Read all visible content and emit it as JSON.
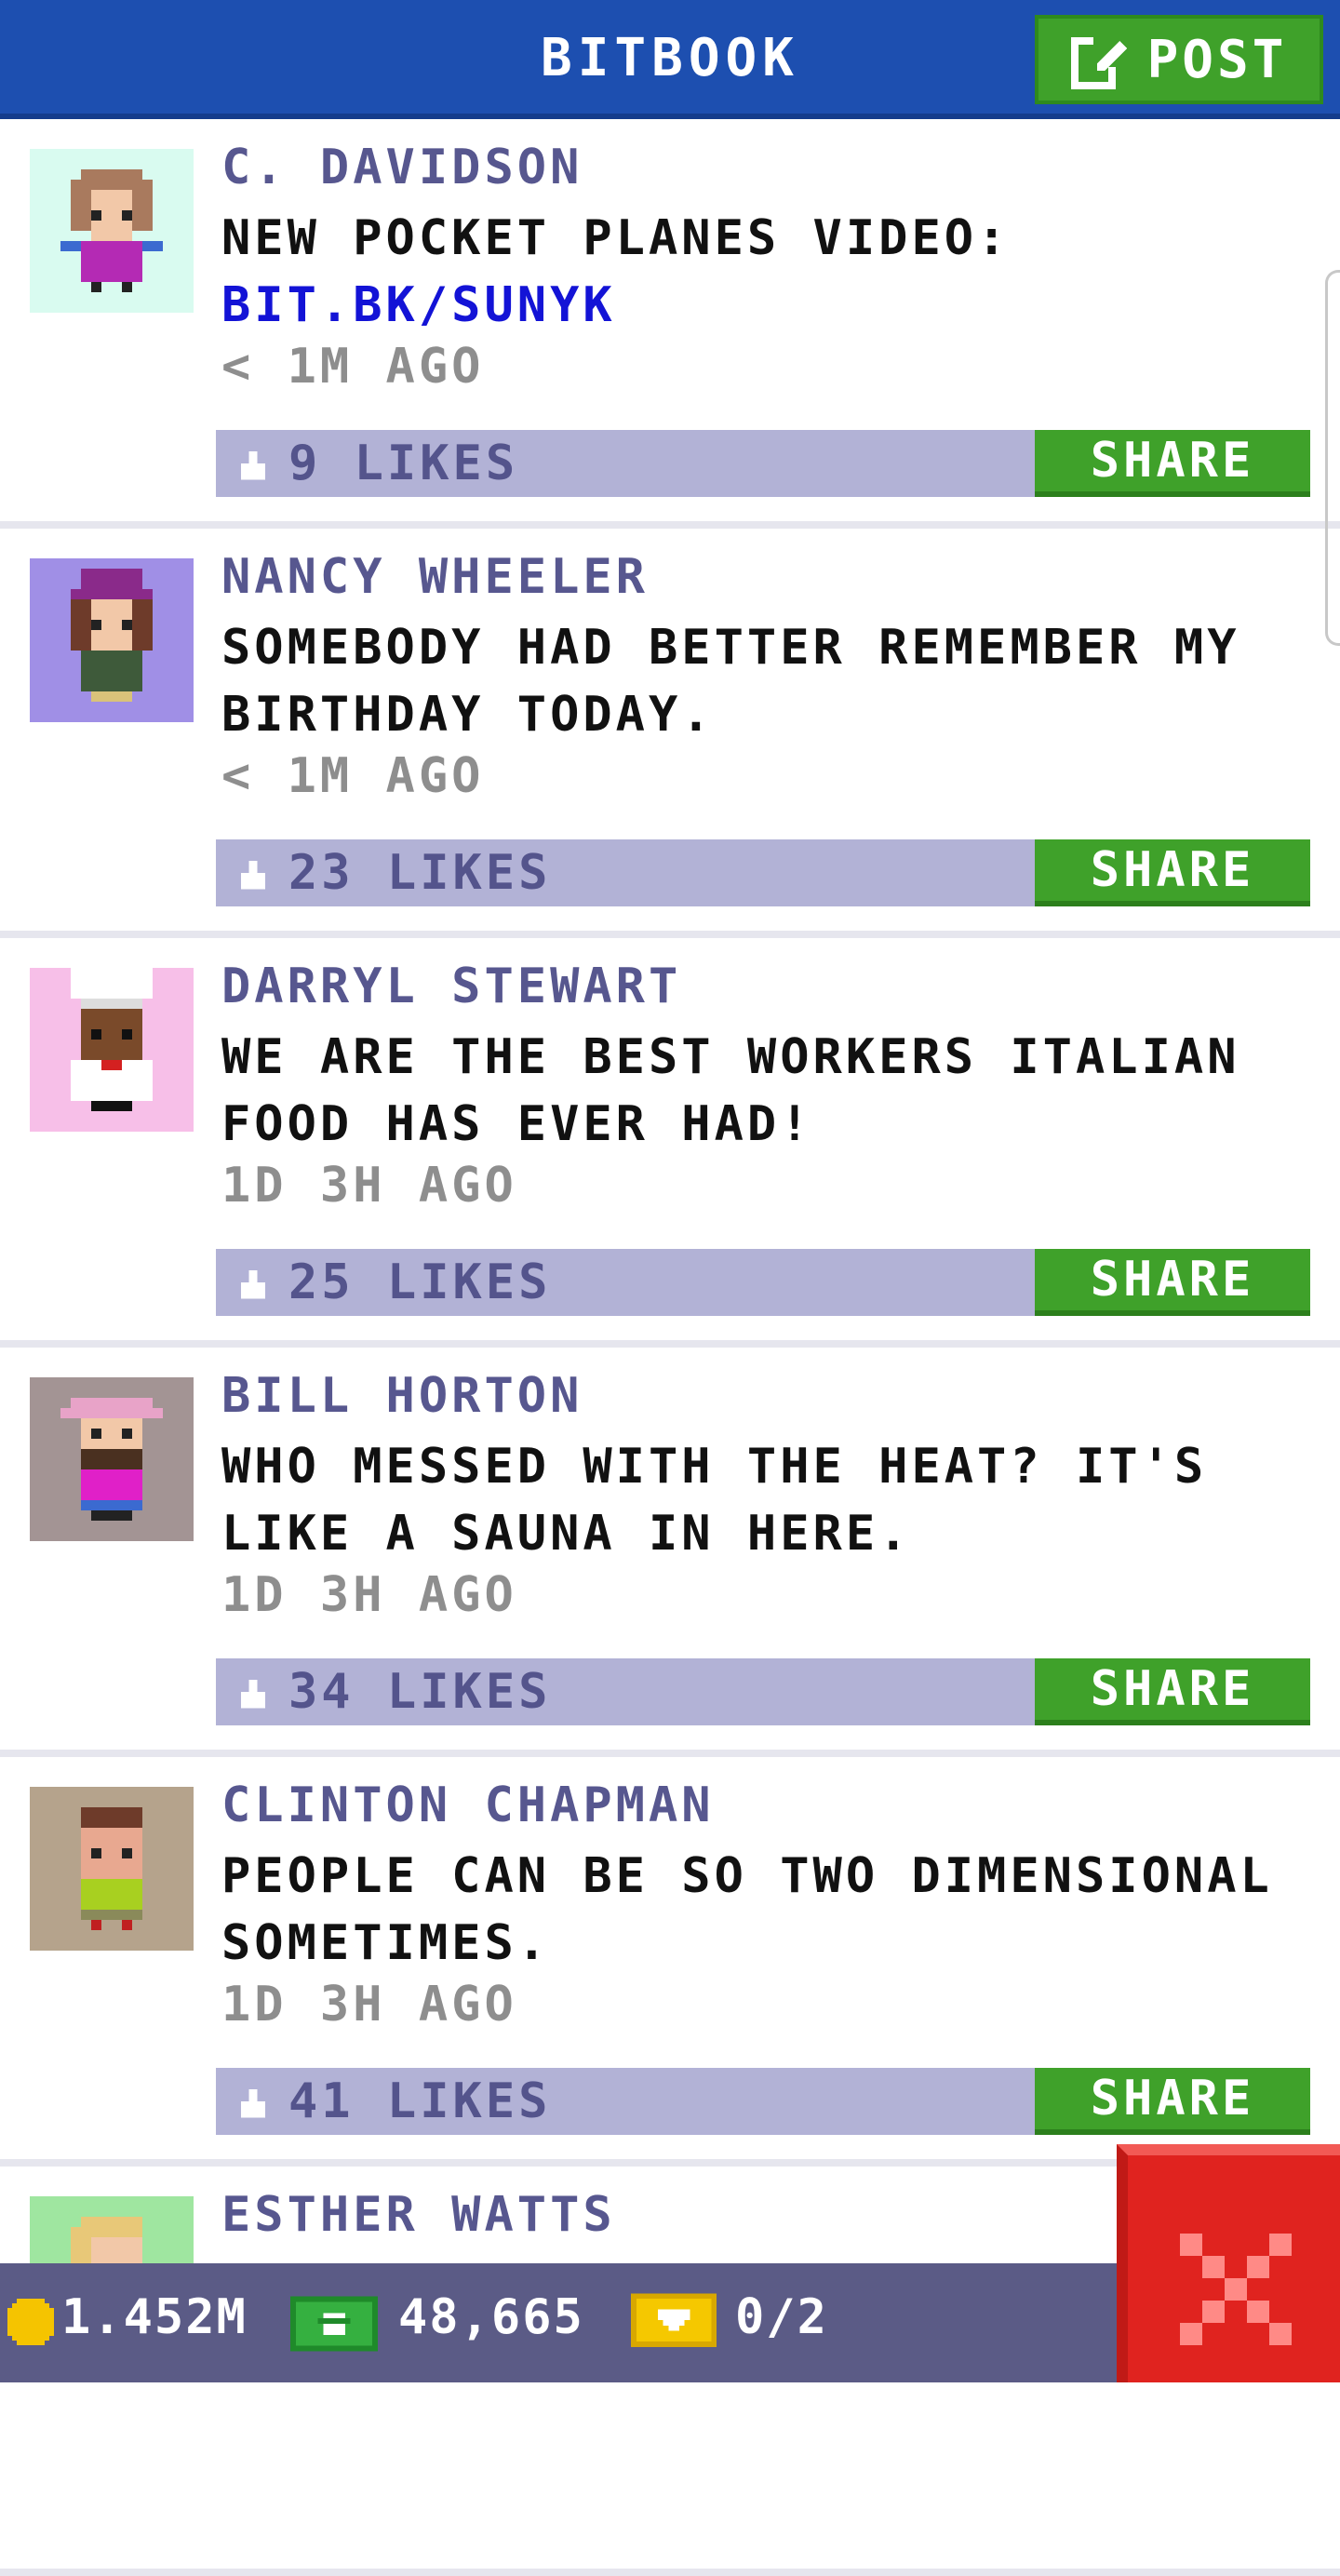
{
  "header": {
    "title": "BITBOOK",
    "post_label": "POST"
  },
  "posts": [
    {
      "author": "C. DAVIDSON",
      "text": "NEW POCKET PLANES VIDEO:",
      "link": "BIT.BK/SUNYK",
      "time": "< 1M AGO",
      "likes": "9 LIKES",
      "share": "SHARE",
      "avatar_bg": "#d9fbf0"
    },
    {
      "author": "NANCY WHEELER",
      "text": "SOMEBODY HAD BETTER REMEMBER MY BIRTHDAY TODAY.",
      "time": "< 1M AGO",
      "likes": "23 LIKES",
      "share": "SHARE",
      "avatar_bg": "#a08fe6"
    },
    {
      "author": "DARRYL STEWART",
      "text": "WE ARE THE BEST WORKERS ITALIAN FOOD HAS EVER HAD!",
      "time": "1D 3H AGO",
      "likes": "25 LIKES",
      "share": "SHARE",
      "avatar_bg": "#f7bfe8"
    },
    {
      "author": "BILL HORTON",
      "text": "WHO MESSED WITH THE HEAT? IT'S LIKE A SAUNA IN HERE.",
      "time": "1D 3H AGO",
      "likes": "34 LIKES",
      "share": "SHARE",
      "avatar_bg": "#a39494"
    },
    {
      "author": "CLINTON CHAPMAN",
      "text": "PEOPLE CAN BE SO TWO DIMENSIONAL SOMETIMES.",
      "time": "1D 3H AGO",
      "likes": "41 LIKES",
      "share": "SHARE",
      "avatar_bg": "#b5a38c"
    },
    {
      "author": "ESTHER WATTS",
      "avatar_bg": "#9fe6a0"
    }
  ],
  "bottom_bar": {
    "coins": "1.452M",
    "bux": "48,665",
    "tickets": "0/2"
  },
  "colors": {
    "header": "#1d4fb0",
    "accent_green": "#3fa12a",
    "likes_bar": "#b2b2d6",
    "bottom_bar": "#5b5b86",
    "close_red": "#e0231f"
  },
  "icons": {
    "post": "edit-icon",
    "like": "thumbs-up-icon",
    "coin": "coin-icon",
    "cash": "bux-icon",
    "ticket": "ticket-icon",
    "close": "close-icon"
  }
}
